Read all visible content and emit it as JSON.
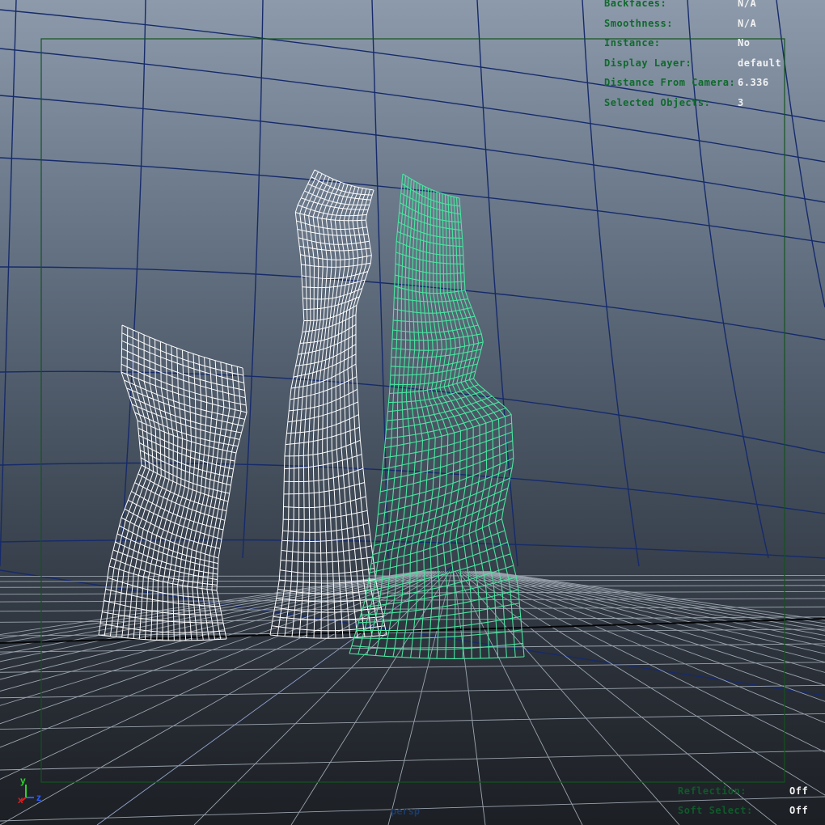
{
  "viewport": {
    "camera_name": "persp",
    "gate_color": "#14521f",
    "selected_color": "#49e6a0",
    "unselected_color": "#ffffff",
    "grid_color": "#9aa3ad",
    "curved_grid_color": "#162a6b"
  },
  "hud_top": [
    {
      "label": "Backfaces:",
      "value": "N/A"
    },
    {
      "label": "Smoothness:",
      "value": "N/A"
    },
    {
      "label": "Instance:",
      "value": "No"
    },
    {
      "label": "Display Layer:",
      "value": "default"
    },
    {
      "label": "Distance From Camera:",
      "value": "6.336"
    },
    {
      "label": "Selected Objects:",
      "value": "3"
    }
  ],
  "hud_bottom": [
    {
      "label": "Reflection:",
      "value": "Off"
    },
    {
      "label": "Soft Select:",
      "value": "Off"
    }
  ],
  "axis": {
    "x": "x",
    "y": "y",
    "z": "z"
  }
}
